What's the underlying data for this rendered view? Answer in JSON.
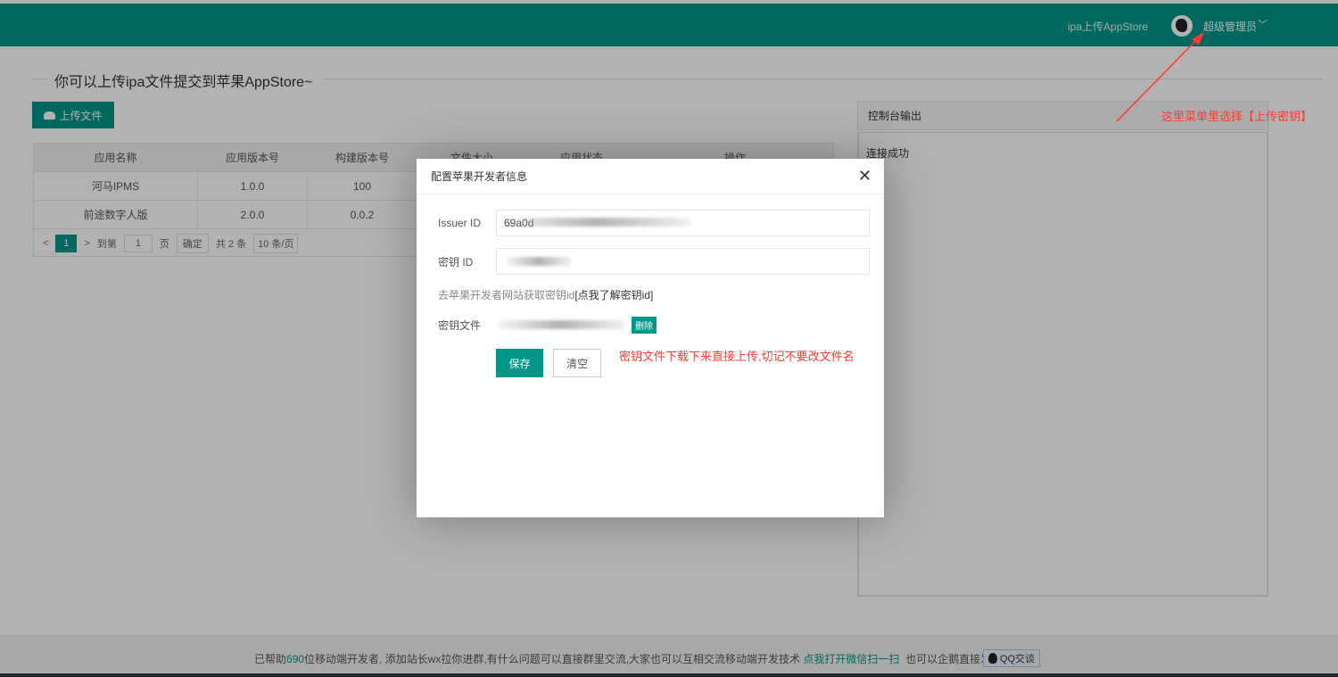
{
  "header": {
    "nav_link": "ipa上传AppStore",
    "user": "超级管理员"
  },
  "main": {
    "legend": "你可以上传ipa文件提交到苹果AppStore~",
    "upload_button": "上传文件",
    "table": {
      "headers": [
        "应用名称",
        "应用版本号",
        "构建版本号",
        "文件大小",
        "应用状态",
        "操作"
      ],
      "rows": [
        [
          "河马IPMS",
          "1.0.0",
          "100"
        ],
        [
          "前途数字人版",
          "2.0.0",
          "0.0.2"
        ]
      ]
    },
    "pager": {
      "prev": "<",
      "current_page": "1",
      "next": ">",
      "goto_label": "到第",
      "goto_value": "1",
      "page_unit": "页",
      "confirm": "确定",
      "total": "共 2 条",
      "page_size": "10 条/页"
    }
  },
  "console": {
    "title": "控制台输出",
    "output": "连接成功"
  },
  "modal": {
    "title": "配置苹果开发者信息",
    "close": "✕",
    "issuer_label": "Issuer ID",
    "issuer_value": "69a0d",
    "key_id_label": "密钥 ID",
    "hint_text": "去苹果开发者网站获取密钥id",
    "hint_link": "[点我了解密钥id]",
    "key_file_label": "密钥文件",
    "delete_label": "删除",
    "save_label": "保存",
    "clear_label": "清空"
  },
  "annotations": {
    "top": "这里菜单里选择【上传密钥】",
    "modal": "密钥文件下载下来直接上传,切记不要改文件名"
  },
  "footer": {
    "text_a": "已帮助",
    "count": "690",
    "text_b": "位移动端开发者, 添加站长wx拉你进群,有什么问题可以直接群里交流,大家也可以互相交流移动端开发技术",
    "link": "点我打开微信扫一扫",
    "text_c": "也可以企鹅直接发起会话",
    "qq_label": "QQ交谈"
  },
  "colors": {
    "primary": "#009688",
    "annotation": "#ff3b30"
  }
}
